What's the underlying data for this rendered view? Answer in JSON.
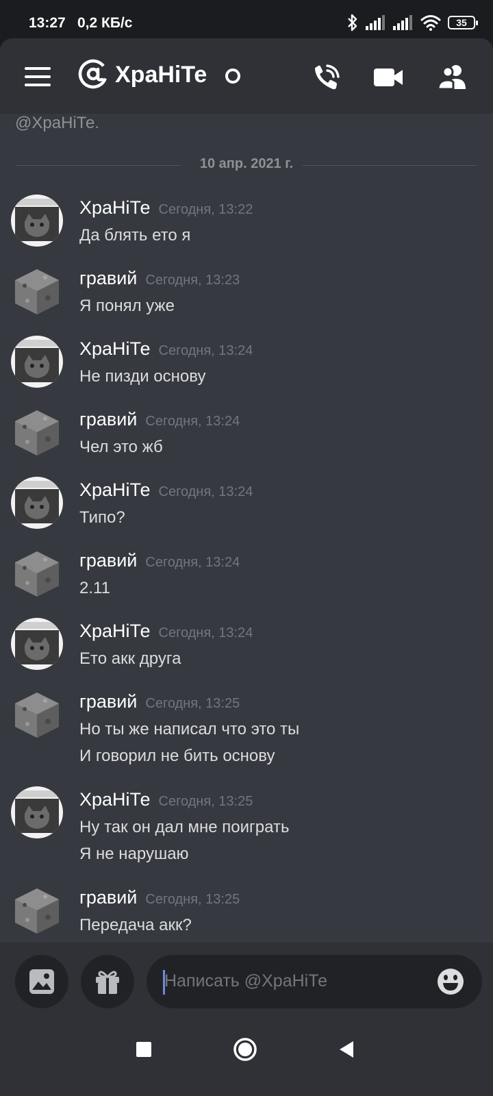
{
  "status_bar": {
    "time": "13:27",
    "speed": "0,2 КБ/с",
    "battery": "35"
  },
  "header": {
    "title": "ХраНіТе",
    "icons": [
      "menu-icon",
      "at-icon",
      "phone-call-icon",
      "video-icon",
      "members-icon"
    ]
  },
  "chat": {
    "cut_text": "@ХраНіТе.",
    "date_divider": "10 апр. 2021 г.",
    "messages": [
      {
        "author": "ХраНіТе",
        "time": "Сегодня, 13:22",
        "lines": [
          "Да блять ето я"
        ]
      },
      {
        "author": "гравий",
        "time": "Сегодня, 13:23",
        "lines": [
          "Я понял уже"
        ]
      },
      {
        "author": "ХраНіТе",
        "time": "Сегодня, 13:24",
        "lines": [
          "Не пизди основу"
        ]
      },
      {
        "author": "гравий",
        "time": "Сегодня, 13:24",
        "lines": [
          "Чел это жб"
        ]
      },
      {
        "author": "ХраНіТе",
        "time": "Сегодня, 13:24",
        "lines": [
          "Типо?"
        ]
      },
      {
        "author": "гравий",
        "time": "Сегодня, 13:24",
        "lines": [
          "2.11"
        ]
      },
      {
        "author": "ХраНіТе",
        "time": "Сегодня, 13:24",
        "lines": [
          "Ето акк друга"
        ]
      },
      {
        "author": "гравий",
        "time": "Сегодня, 13:25",
        "lines": [
          "Но ты же написал что это ты",
          "И говорил не бить основу"
        ]
      },
      {
        "author": "ХраНіТе",
        "time": "Сегодня, 13:25",
        "lines": [
          "Ну так он дал мне поиграть",
          "Я не нарушаю"
        ]
      },
      {
        "author": "гравий",
        "time": "Сегодня, 13:25",
        "lines": [
          "Передача акк?"
        ]
      }
    ]
  },
  "composer": {
    "placeholder": "Написать @ХраНіТе",
    "icons": [
      "image-icon",
      "gift-icon",
      "emoji-icon"
    ]
  },
  "nav": {
    "icons": [
      "recents-icon",
      "home-icon",
      "back-icon"
    ]
  },
  "colors": {
    "background": "#36393f",
    "header": "#2f3136",
    "accent": "#7289da"
  }
}
